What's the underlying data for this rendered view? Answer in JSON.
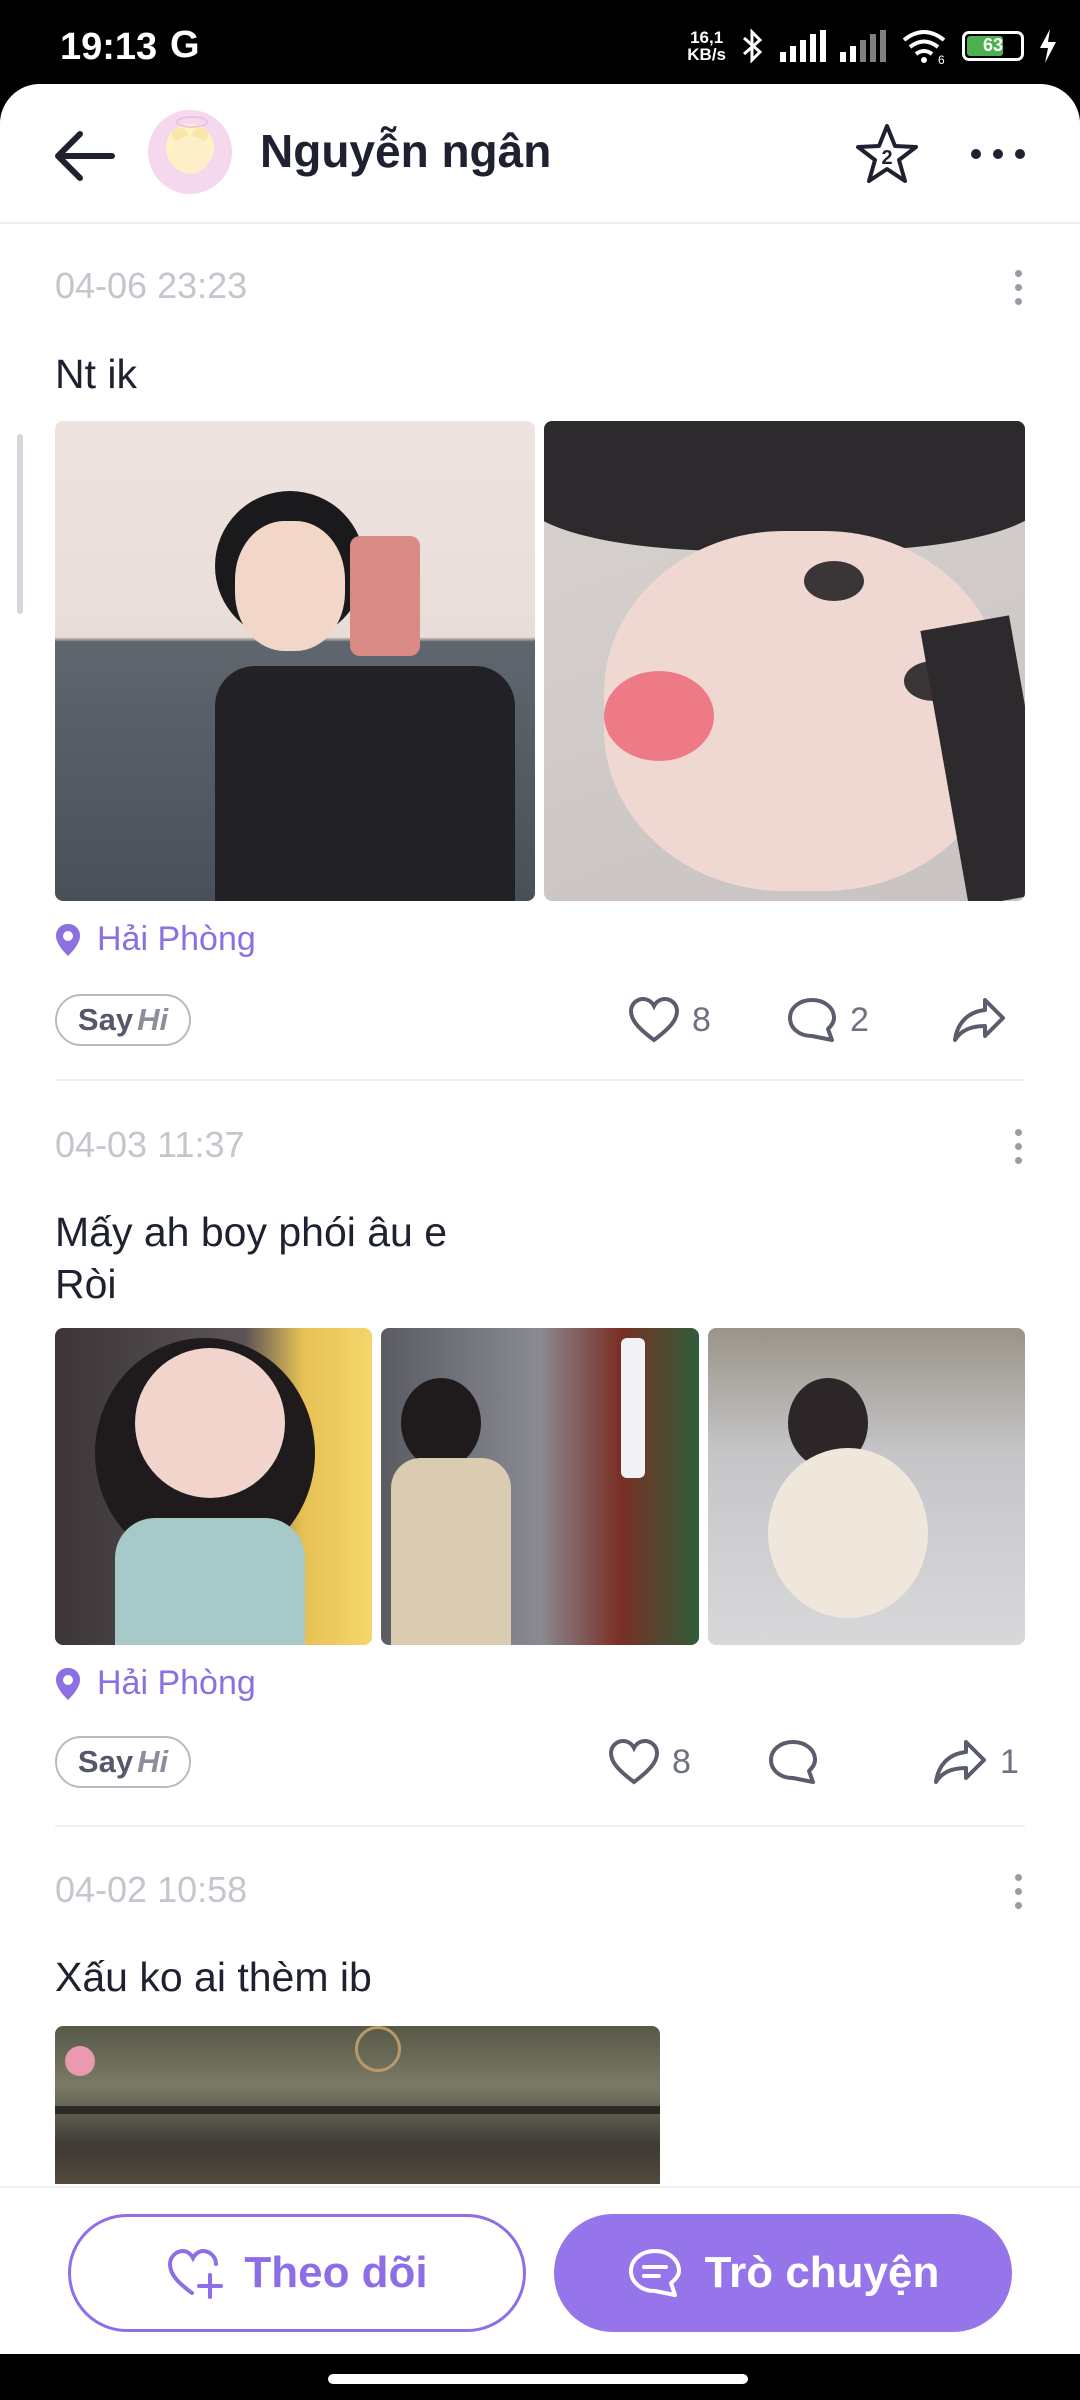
{
  "status_bar": {
    "time": "19:13",
    "carrier_icon": "G",
    "net_speed_value": "16,1",
    "net_speed_unit": "KB/s",
    "wifi_label": "6",
    "battery_percent": "63"
  },
  "header": {
    "user_name": "Nguyễn ngân",
    "star_badge": "2"
  },
  "posts": [
    {
      "date": "04-06 23:23",
      "text": "Nt ik",
      "location": "Hải Phòng",
      "sayhi_say": "Say",
      "sayhi_hi": "Hi",
      "likes": "8",
      "comments": "2",
      "shares": ""
    },
    {
      "date": "04-03 11:37",
      "text_line1": "Mấy ah boy phói âu e",
      "text_line2": "Ròi",
      "location": "Hải Phòng",
      "sayhi_say": "Say",
      "sayhi_hi": "Hi",
      "likes": "8",
      "comments": "",
      "shares": "1"
    },
    {
      "date": "04-02 10:58",
      "text": "Xấu ko ai thèm ib"
    }
  ],
  "bottom_bar": {
    "follow_label": "Theo dõi",
    "chat_label": "Trò chuyện"
  },
  "colors": {
    "accent": "#9674ea",
    "location": "#8c6fe0"
  }
}
